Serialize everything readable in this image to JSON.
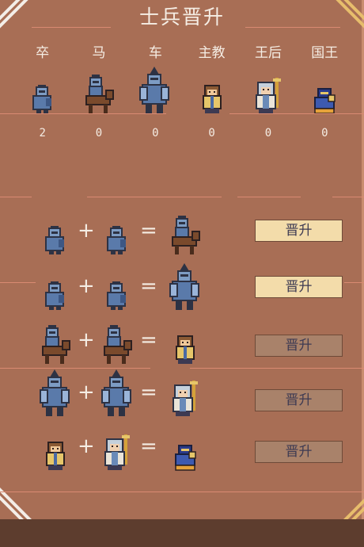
{
  "title": "士兵晋升",
  "pieces": [
    {
      "label": "卒",
      "icon": "pawn-icon",
      "count": "2"
    },
    {
      "label": "马",
      "icon": "knight-icon",
      "count": "0"
    },
    {
      "label": "车",
      "icon": "rook-icon",
      "count": "0"
    },
    {
      "label": "主教",
      "icon": "bishop-icon",
      "count": "0"
    },
    {
      "label": "王后",
      "icon": "queen-icon",
      "count": "0"
    },
    {
      "label": "国王",
      "icon": "king-icon",
      "count": "0"
    }
  ],
  "recipes": [
    {
      "a": "pawn",
      "b": "pawn",
      "result": "knight",
      "plus": "+",
      "equals": "=",
      "button": "晋升",
      "enabled": true
    },
    {
      "a": "pawn",
      "b": "pawn",
      "result": "rook",
      "plus": "+",
      "equals": "=",
      "button": "晋升",
      "enabled": true
    },
    {
      "a": "knight",
      "b": "knight",
      "result": "bishop",
      "plus": "+",
      "equals": "=",
      "button": "晋升",
      "enabled": false
    },
    {
      "a": "rook",
      "b": "rook",
      "result": "queen",
      "plus": "+",
      "equals": "=",
      "button": "晋升",
      "enabled": false
    },
    {
      "a": "bishop",
      "b": "queen",
      "result": "king",
      "plus": "+",
      "equals": "=",
      "button": "晋升",
      "enabled": false
    }
  ],
  "colors": {
    "background": "#a86e55",
    "bottom_bar": "#5d3d2e",
    "button_enabled": "#f3dcaa",
    "button_disabled": "#a9826a",
    "button_text": "#3d3a52",
    "text": "#f5ede4"
  }
}
